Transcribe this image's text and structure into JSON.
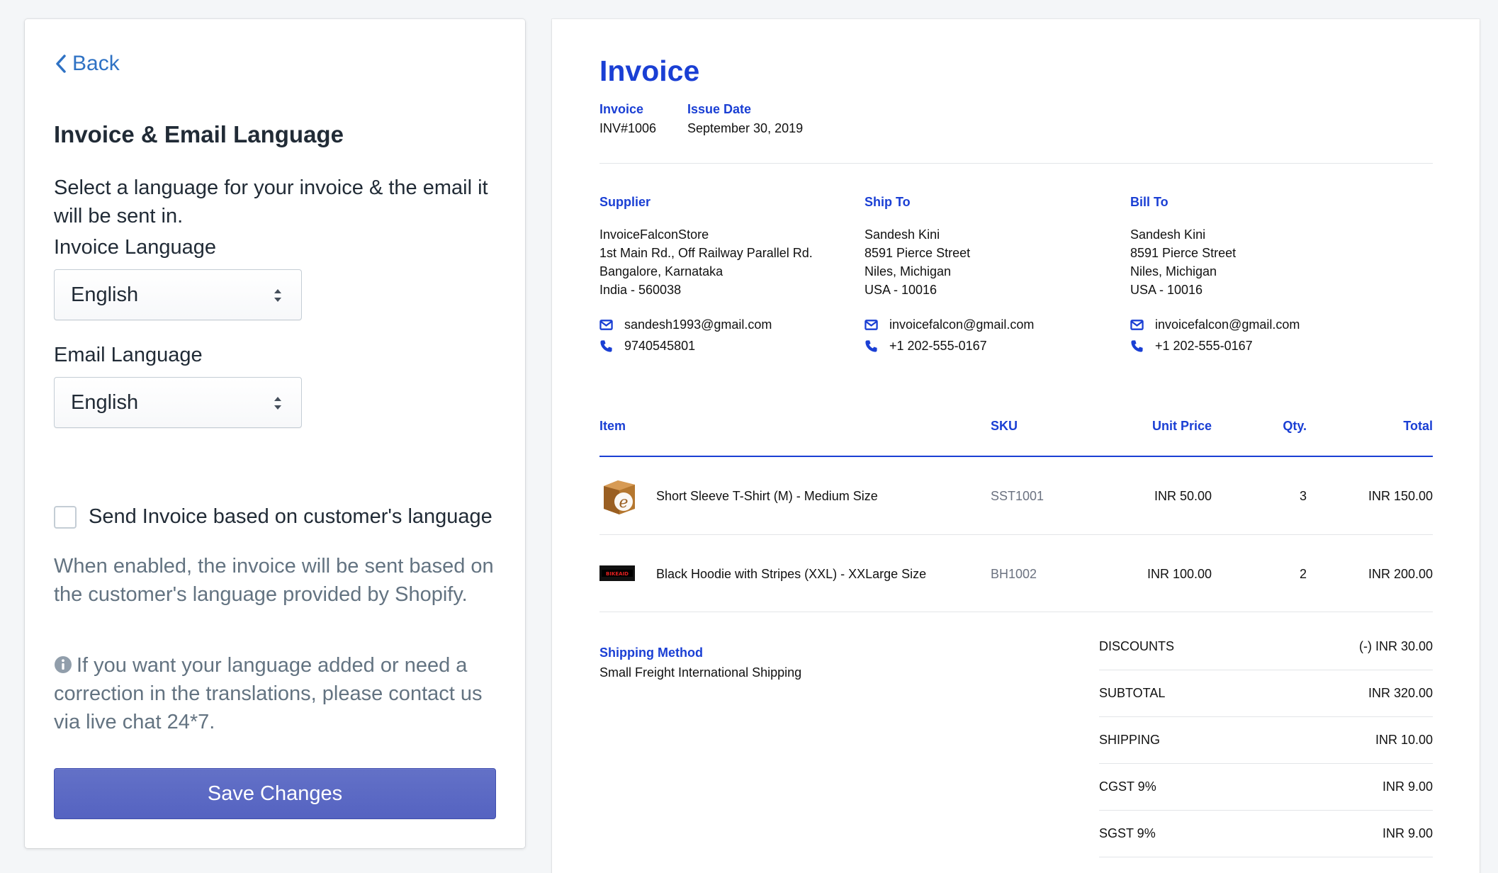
{
  "settings": {
    "back_label": "Back",
    "title": "Invoice & Email Language",
    "description": "Select a language for your invoice & the email it will be sent in.",
    "invoice_language": {
      "label": "Invoice Language",
      "value": "English"
    },
    "email_language": {
      "label": "Email Language",
      "value": "English"
    },
    "customer_language": {
      "checkbox_label": "Send Invoice based on customer's language",
      "checked": false,
      "help": "When enabled, the invoice will be sent based on the customer's language provided by Shopify."
    },
    "info_note": "If you want your language added or need a correction in the translations, please contact us via live chat 24*7.",
    "save_label": "Save Changes"
  },
  "invoice": {
    "title": "Invoice",
    "number_label": "Invoice",
    "number": "INV#1006",
    "date_label": "Issue Date",
    "date": "September 30, 2019",
    "supplier": {
      "label": "Supplier",
      "lines": [
        "InvoiceFalconStore",
        "1st Main Rd., Off Railway Parallel Rd.",
        "Bangalore, Karnataka",
        "India - 560038"
      ],
      "email": "sandesh1993@gmail.com",
      "phone": "9740545801"
    },
    "ship_to": {
      "label": "Ship To",
      "lines": [
        "Sandesh Kini",
        "8591 Pierce Street",
        "Niles, Michigan",
        "USA - 10016"
      ],
      "email": "invoicefalcon@gmail.com",
      "phone": "+1 202-555-0167"
    },
    "bill_to": {
      "label": "Bill To",
      "lines": [
        "Sandesh Kini",
        "8591 Pierce Street",
        "Niles, Michigan",
        "USA - 10016"
      ],
      "email": "invoicefalcon@gmail.com",
      "phone": "+1 202-555-0167"
    },
    "columns": {
      "item": "Item",
      "sku": "SKU",
      "unit_price": "Unit Price",
      "qty": "Qty.",
      "total": "Total"
    },
    "items": [
      {
        "name": "Short Sleeve T-Shirt (M) - Medium Size",
        "sku": "SST1001",
        "unit_price": "INR 50.00",
        "qty": "3",
        "total": "INR 150.00",
        "thumb_icon": "package-e-icon"
      },
      {
        "name": "Black Hoodie with Stripes (XXL) - XXLarge Size",
        "sku": "BH1002",
        "unit_price": "INR 100.00",
        "qty": "2",
        "total": "INR 200.00",
        "thumb_icon": "bikeaid-logo",
        "thumb_text": "BIKEAID"
      }
    ],
    "shipping_method_label": "Shipping Method",
    "shipping_method": "Small Freight International Shipping",
    "totals": [
      {
        "label": "DISCOUNTS",
        "value": "(-) INR 30.00"
      },
      {
        "label": "SUBTOTAL",
        "value": "INR 320.00"
      },
      {
        "label": "SHIPPING",
        "value": "INR 10.00"
      },
      {
        "label": "CGST 9%",
        "value": "INR 9.00"
      },
      {
        "label": "SGST 9%",
        "value": "INR 9.00"
      }
    ]
  },
  "colors": {
    "accent_blue": "#1a3fd4",
    "link_blue": "#2f72c4",
    "button_indigo": "#5c6ac4"
  }
}
